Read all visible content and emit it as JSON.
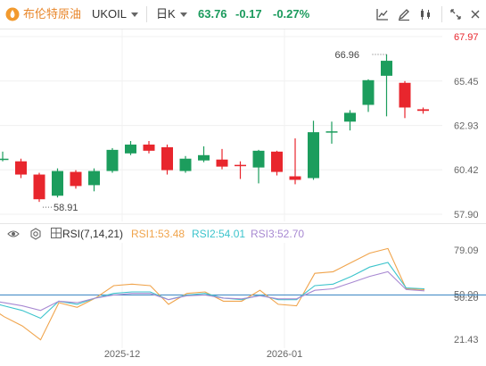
{
  "header": {
    "instrument": "布伦特原油",
    "symbol": "UKOIL",
    "period": "日K",
    "price": "63.76",
    "change": "-0.17",
    "change_pct": "-0.27%",
    "colors": {
      "instrument": "#e8862a",
      "symbol": "#333333",
      "price": "#1a9a5c",
      "logo": "#f29a2e"
    }
  },
  "toolbar": {
    "icons": [
      "line-chart-icon",
      "draw-pencil-icon",
      "indicator-settings-icon",
      "expand-icon"
    ]
  },
  "rsi": {
    "label": "RSI(7,14,21)",
    "rsi1_label": "RSI1:53.48",
    "rsi2_label": "RSI2:54.01",
    "rsi3_label": "RSI3:52.70",
    "icons": [
      "eye-icon",
      "settings-icon",
      "grid-icon"
    ]
  },
  "chart_data": [
    {
      "type": "candlestick",
      "title": "",
      "x_ticks": [
        "2025-12",
        "2026-01"
      ],
      "y_ticks": [
        "67.97",
        "65.45",
        "62.93",
        "60.42",
        "57.90"
      ],
      "ylim": [
        57.9,
        67.97
      ],
      "annotations": [
        {
          "label": "66.96",
          "type": "max"
        },
        {
          "label": "58.91",
          "type": "min"
        }
      ],
      "colors": {
        "up": "#1c9d5d",
        "down": "#e8262d"
      },
      "candles": [
        {
          "open": 61.05,
          "close": 61.05,
          "high": 61.45,
          "low": 60.9
        },
        {
          "open": 60.9,
          "close": 60.15,
          "high": 61.05,
          "low": 59.95
        },
        {
          "open": 60.15,
          "close": 58.75,
          "high": 60.25,
          "low": 58.6
        },
        {
          "open": 58.95,
          "close": 60.35,
          "high": 60.5,
          "low": 58.85
        },
        {
          "open": 60.3,
          "close": 59.5,
          "high": 60.4,
          "low": 59.35
        },
        {
          "open": 59.55,
          "close": 60.35,
          "high": 60.5,
          "low": 59.2
        },
        {
          "open": 60.35,
          "close": 61.55,
          "high": 61.65,
          "low": 60.25
        },
        {
          "open": 61.35,
          "close": 61.85,
          "high": 62.05,
          "low": 61.25
        },
        {
          "open": 61.85,
          "close": 61.5,
          "high": 62.05,
          "low": 61.35
        },
        {
          "open": 61.7,
          "close": 60.4,
          "high": 61.85,
          "low": 60.15
        },
        {
          "open": 60.35,
          "close": 61.05,
          "high": 61.2,
          "low": 60.25
        },
        {
          "open": 60.95,
          "close": 61.25,
          "high": 61.75,
          "low": 60.85
        },
        {
          "open": 61.0,
          "close": 60.6,
          "high": 61.6,
          "low": 60.45
        },
        {
          "open": 60.7,
          "close": 60.65,
          "high": 60.9,
          "low": 59.9
        },
        {
          "open": 60.55,
          "close": 61.5,
          "high": 61.55,
          "low": 59.65
        },
        {
          "open": 61.45,
          "close": 60.3,
          "high": 61.5,
          "low": 60.1
        },
        {
          "open": 60.05,
          "close": 59.85,
          "high": 62.2,
          "low": 59.6
        },
        {
          "open": 59.95,
          "close": 62.55,
          "high": 63.2,
          "low": 59.85
        },
        {
          "open": 62.55,
          "close": 62.6,
          "high": 63.15,
          "low": 61.9
        },
        {
          "open": 63.15,
          "close": 63.65,
          "high": 63.8,
          "low": 62.65
        },
        {
          "open": 64.1,
          "close": 65.5,
          "high": 65.55,
          "low": 63.7
        },
        {
          "open": 65.75,
          "close": 66.6,
          "high": 66.96,
          "low": 63.45
        },
        {
          "open": 65.35,
          "close": 63.95,
          "high": 65.45,
          "low": 63.35
        },
        {
          "open": 63.85,
          "close": 63.76,
          "high": 63.95,
          "low": 63.6
        }
      ]
    },
    {
      "type": "line",
      "title": "RSI(7,14,21)",
      "y_ticks": [
        "79.09",
        "50.00",
        "50.20",
        "21.43"
      ],
      "ylim": [
        21.43,
        79.09
      ],
      "reference_line": 50.0,
      "series": [
        {
          "name": "RSI1",
          "color": "#f0a44c",
          "values": [
            44,
            36,
            30,
            21,
            45,
            42,
            48,
            56,
            57,
            56,
            44,
            51,
            52,
            46,
            46,
            53,
            44,
            43,
            64,
            65,
            71,
            77,
            80,
            54,
            53.48
          ]
        },
        {
          "name": "RSI2",
          "color": "#3cc4cc",
          "values": [
            46,
            43,
            40,
            35,
            46,
            44,
            48,
            51,
            52,
            52,
            47,
            50,
            51,
            48,
            47,
            50,
            47,
            47,
            56,
            57,
            62,
            68,
            71,
            54.5,
            54.01
          ]
        },
        {
          "name": "RSI3",
          "color": "#a889d2",
          "values": [
            47,
            45,
            43,
            40,
            46,
            45,
            48,
            50,
            51,
            51,
            47,
            49.5,
            50,
            48,
            47.5,
            49.5,
            47.5,
            47.5,
            53,
            54,
            58,
            62,
            65,
            53.5,
            52.7
          ]
        }
      ]
    }
  ]
}
